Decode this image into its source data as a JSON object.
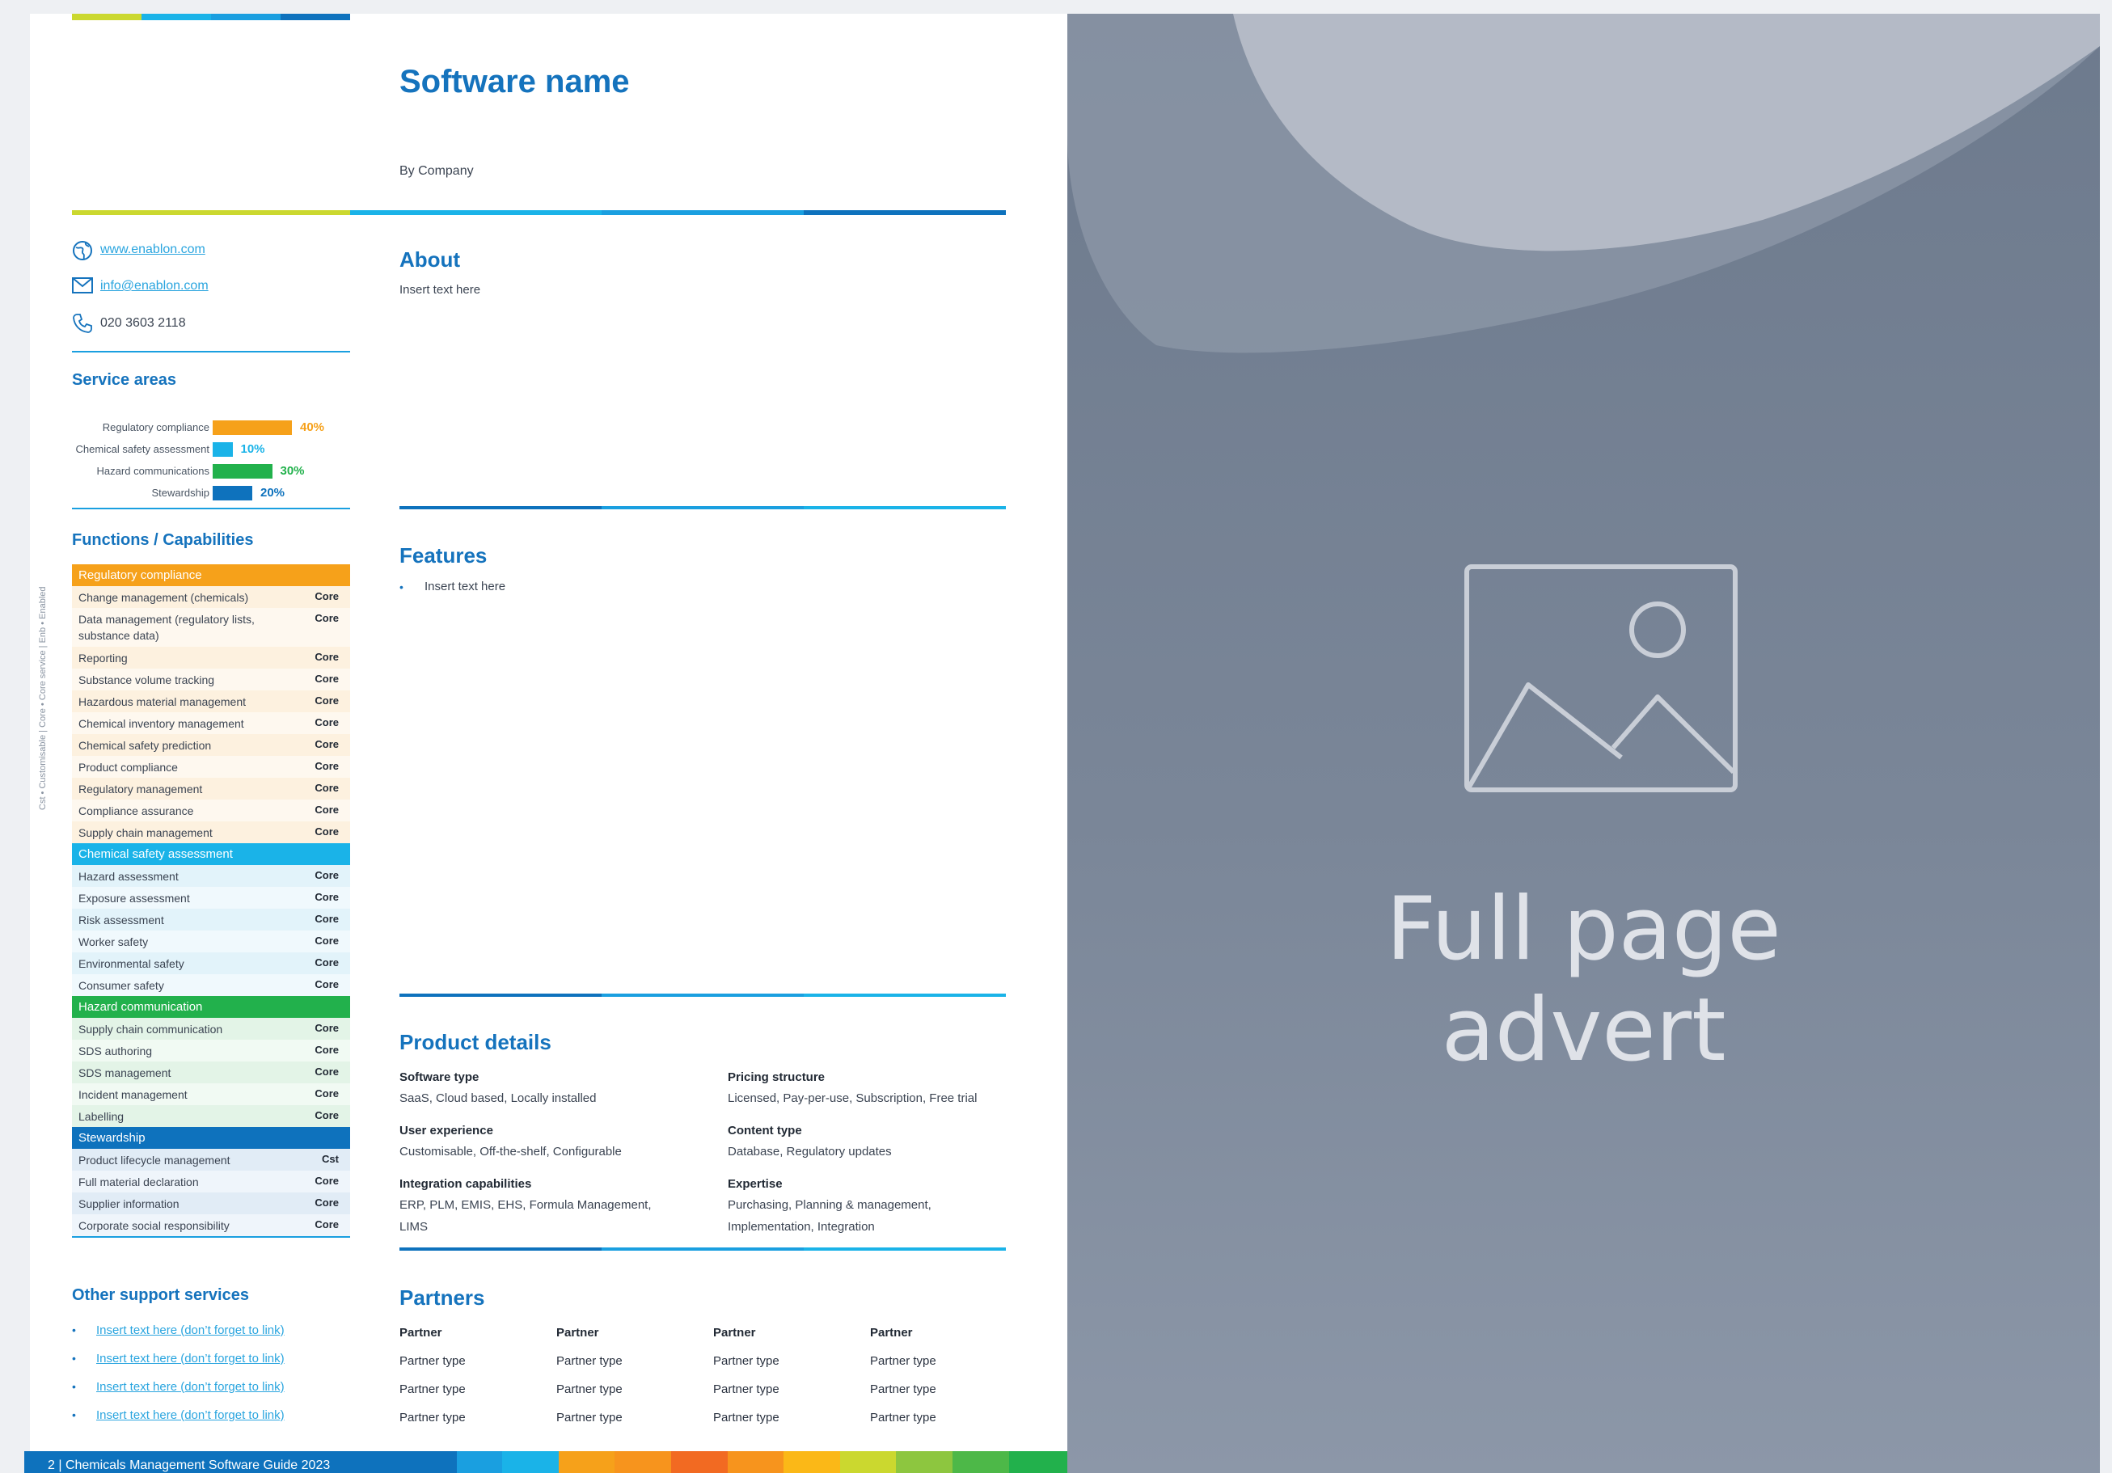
{
  "software": {
    "title": "Software name",
    "by_company": "By Company"
  },
  "contact": {
    "website": "www.enablon.com",
    "email": "info@enablon.com",
    "phone": "020 3603 2118"
  },
  "service_areas": {
    "title": "Service areas",
    "items": [
      {
        "label": "Regulatory compliance",
        "percent": 40,
        "percent_label": "40%",
        "color": "#f6a11a"
      },
      {
        "label": "Chemical safety assessment",
        "percent": 10,
        "percent_label": "10%",
        "color": "#1ab3e8"
      },
      {
        "label": "Hazard communications",
        "percent": 30,
        "percent_label": "30%",
        "color": "#22b14c"
      },
      {
        "label": "Stewardship",
        "percent": 20,
        "percent_label": "20%",
        "color": "#0e72bd"
      }
    ]
  },
  "legend_vertical": "Cst • Customisable | Core • Core service | Enb • Enabled",
  "capabilities": {
    "title": "Functions / Capabilities",
    "groups": [
      {
        "name": "Regulatory compliance",
        "color": "#f6a11a",
        "rows": [
          {
            "name": "Change management (chemicals)",
            "value": "Core"
          },
          {
            "name": "Data management (regulatory lists, substance data)",
            "value": "Core"
          },
          {
            "name": "Reporting",
            "value": "Core"
          },
          {
            "name": "Substance volume tracking",
            "value": "Core"
          },
          {
            "name": "Hazardous material management",
            "value": "Core"
          },
          {
            "name": "Chemical inventory management",
            "value": "Core"
          },
          {
            "name": "Chemical safety prediction",
            "value": "Core"
          },
          {
            "name": "Product compliance",
            "value": "Core"
          },
          {
            "name": "Regulatory management",
            "value": "Core"
          },
          {
            "name": "Compliance assurance",
            "value": "Core"
          },
          {
            "name": "Supply chain management",
            "value": "Core"
          }
        ]
      },
      {
        "name": "Chemical safety assessment",
        "color": "#1ab3e8",
        "rows": [
          {
            "name": "Hazard assessment",
            "value": "Core"
          },
          {
            "name": "Exposure assessment",
            "value": "Core"
          },
          {
            "name": "Risk assessment",
            "value": "Core"
          },
          {
            "name": "Worker safety",
            "value": "Core"
          },
          {
            "name": "Environmental safety",
            "value": "Core"
          },
          {
            "name": "Consumer safety",
            "value": "Core"
          }
        ]
      },
      {
        "name": "Hazard communication",
        "color": "#22b14c",
        "rows": [
          {
            "name": "Supply chain communication",
            "value": "Core"
          },
          {
            "name": "SDS authoring",
            "value": "Core"
          },
          {
            "name": "SDS management",
            "value": "Core"
          },
          {
            "name": "Incident management",
            "value": "Core"
          },
          {
            "name": "Labelling",
            "value": "Core"
          }
        ]
      },
      {
        "name": "Stewardship",
        "color": "#0e72bd",
        "rows": [
          {
            "name": "Product lifecycle management",
            "value": "Cst"
          },
          {
            "name": "Full material declaration",
            "value": "Core"
          },
          {
            "name": "Supplier information",
            "value": "Core"
          },
          {
            "name": "Corporate social responsibility",
            "value": "Core"
          }
        ]
      }
    ]
  },
  "support": {
    "title": "Other support services",
    "items": [
      "Insert text here (don’t forget to link)",
      "Insert text here (don’t forget to link)",
      "Insert text here (don’t forget to link)",
      "Insert text here (don’t forget to link)"
    ]
  },
  "about": {
    "title": "About",
    "text": "Insert text here"
  },
  "features": {
    "title": "Features",
    "items": [
      "Insert text here"
    ]
  },
  "product_details": {
    "title": "Product details",
    "software_type_label": "Software type",
    "software_type_value": "SaaS, Cloud based, Locally installed",
    "pricing_label": "Pricing structure",
    "pricing_value": "Licensed, Pay-per-use, Subscription, Free trial",
    "ux_label": "User experience",
    "ux_value": "Customisable, Off-the-shelf, Configurable",
    "content_label": "Content type",
    "content_value": "Database, Regulatory updates",
    "integration_label": "Integration capabilities",
    "integration_value": "ERP, PLM, EMIS, EHS, Formula Management, LIMS",
    "expertise_label": "Expertise",
    "expertise_value": "Purchasing, Planning & management, Implementation, Integration"
  },
  "partners": {
    "title": "Partners",
    "header": [
      "Partner",
      "Partner",
      "Partner",
      "Partner"
    ],
    "rows": [
      [
        "Partner type",
        "Partner type",
        "Partner type",
        "Partner type"
      ],
      [
        "Partner type",
        "Partner type",
        "Partner type",
        "Partner type"
      ],
      [
        "Partner type",
        "Partner type",
        "Partner type",
        "Partner type"
      ]
    ]
  },
  "footer": {
    "text": "2 | Chemicals Management Software Guide 2023"
  },
  "advert": {
    "line1": "Full page",
    "line2": "advert"
  },
  "icons": [
    "globe-icon",
    "envelope-icon",
    "phone-icon",
    "image-placeholder-icon"
  ]
}
